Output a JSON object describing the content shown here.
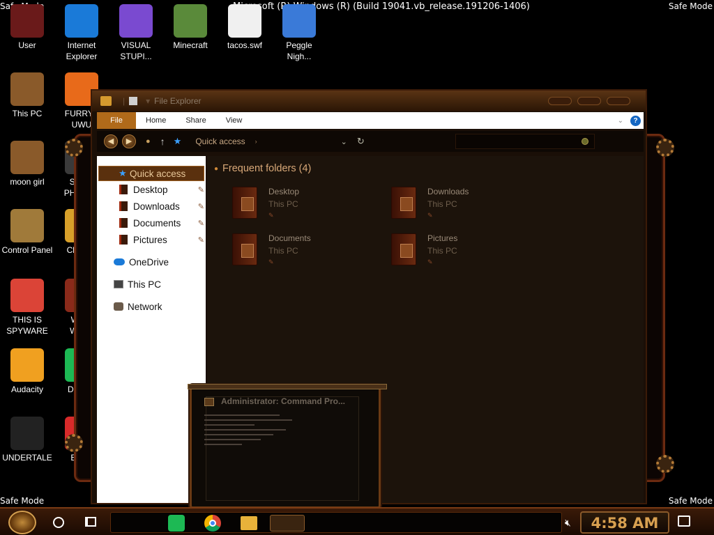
{
  "top_banner": "Microsoft (R) Windows (R) (Build 19041.vb_release.191206-1406)",
  "safe_mode": "Safe Mode",
  "desktop_icons": [
    {
      "label": "User",
      "icon": "user-icon",
      "color": "#6a1a1a"
    },
    {
      "label": "Internet\nExplorer",
      "icon": "edge-icon",
      "color": "#1a7ad8"
    },
    {
      "label": "VISUAL\nSTUPI...",
      "icon": "visual-studio-icon",
      "color": "#7a4ad0"
    },
    {
      "label": "Minecraft",
      "icon": "minecraft-icon",
      "color": "#5a8a3a"
    },
    {
      "label": "tacos.swf",
      "icon": "flash-file-icon",
      "color": "#f0f0f0"
    },
    {
      "label": "Peggle\nNigh...",
      "icon": "peggle-icon",
      "color": "#3a7ad8"
    },
    {
      "label": "This PC",
      "icon": "this-pc-icon",
      "color": "#8a5a2a"
    },
    {
      "label": "FURRYF\nUWU",
      "icon": "firefox-icon",
      "color": "#e86a1a"
    },
    {
      "label": "moon girl",
      "icon": "moon-girl-icon",
      "color": "#8a5a2a"
    },
    {
      "label": "SHITT\nPHOTOS",
      "icon": "photos-icon",
      "color": "#3a3a3a"
    },
    {
      "label": "Control Panel",
      "icon": "control-panel-icon",
      "color": "#a07a3a"
    },
    {
      "label": "ChonkE",
      "icon": "chonk-icon",
      "color": "#d8a02a"
    },
    {
      "label": "THIS IS\nSPYWARE",
      "icon": "chrome-icon",
      "color": "#db4437"
    },
    {
      "label": "WWE\nWrestl",
      "icon": "wwe-icon",
      "color": "#8a2a1a"
    },
    {
      "label": "Audacity",
      "icon": "audacity-icon",
      "color": "#f0a020"
    },
    {
      "label": "Dissent",
      "icon": "spotify-icon",
      "color": "#1db954"
    },
    {
      "label": "UNDERTALE",
      "icon": "unity-icon",
      "color": "#222222"
    },
    {
      "label": "Embe\nDev",
      "icon": "embarcadero-icon",
      "color": "#d82a2a"
    }
  ],
  "explorer": {
    "title": "File Explorer",
    "ribbon": {
      "file": "File",
      "home": "Home",
      "share": "Share",
      "view": "View",
      "help": "?"
    },
    "address": "Quick access",
    "nav": {
      "quick_access": "Quick access",
      "pinned": [
        "Desktop",
        "Downloads",
        "Documents",
        "Pictures"
      ],
      "onedrive": "OneDrive",
      "this_pc": "This PC",
      "network": "Network"
    },
    "frequent_header": "Frequent folders (4)",
    "tiles": [
      {
        "name": "Desktop",
        "sub": "This PC"
      },
      {
        "name": "Downloads",
        "sub": "This PC"
      },
      {
        "name": "Documents",
        "sub": "This PC"
      },
      {
        "name": "Pictures",
        "sub": "This PC"
      }
    ]
  },
  "cmd_preview": {
    "title": "Administrator: Command Pro..."
  },
  "taskbar": {
    "clock": "4:58 AM"
  }
}
